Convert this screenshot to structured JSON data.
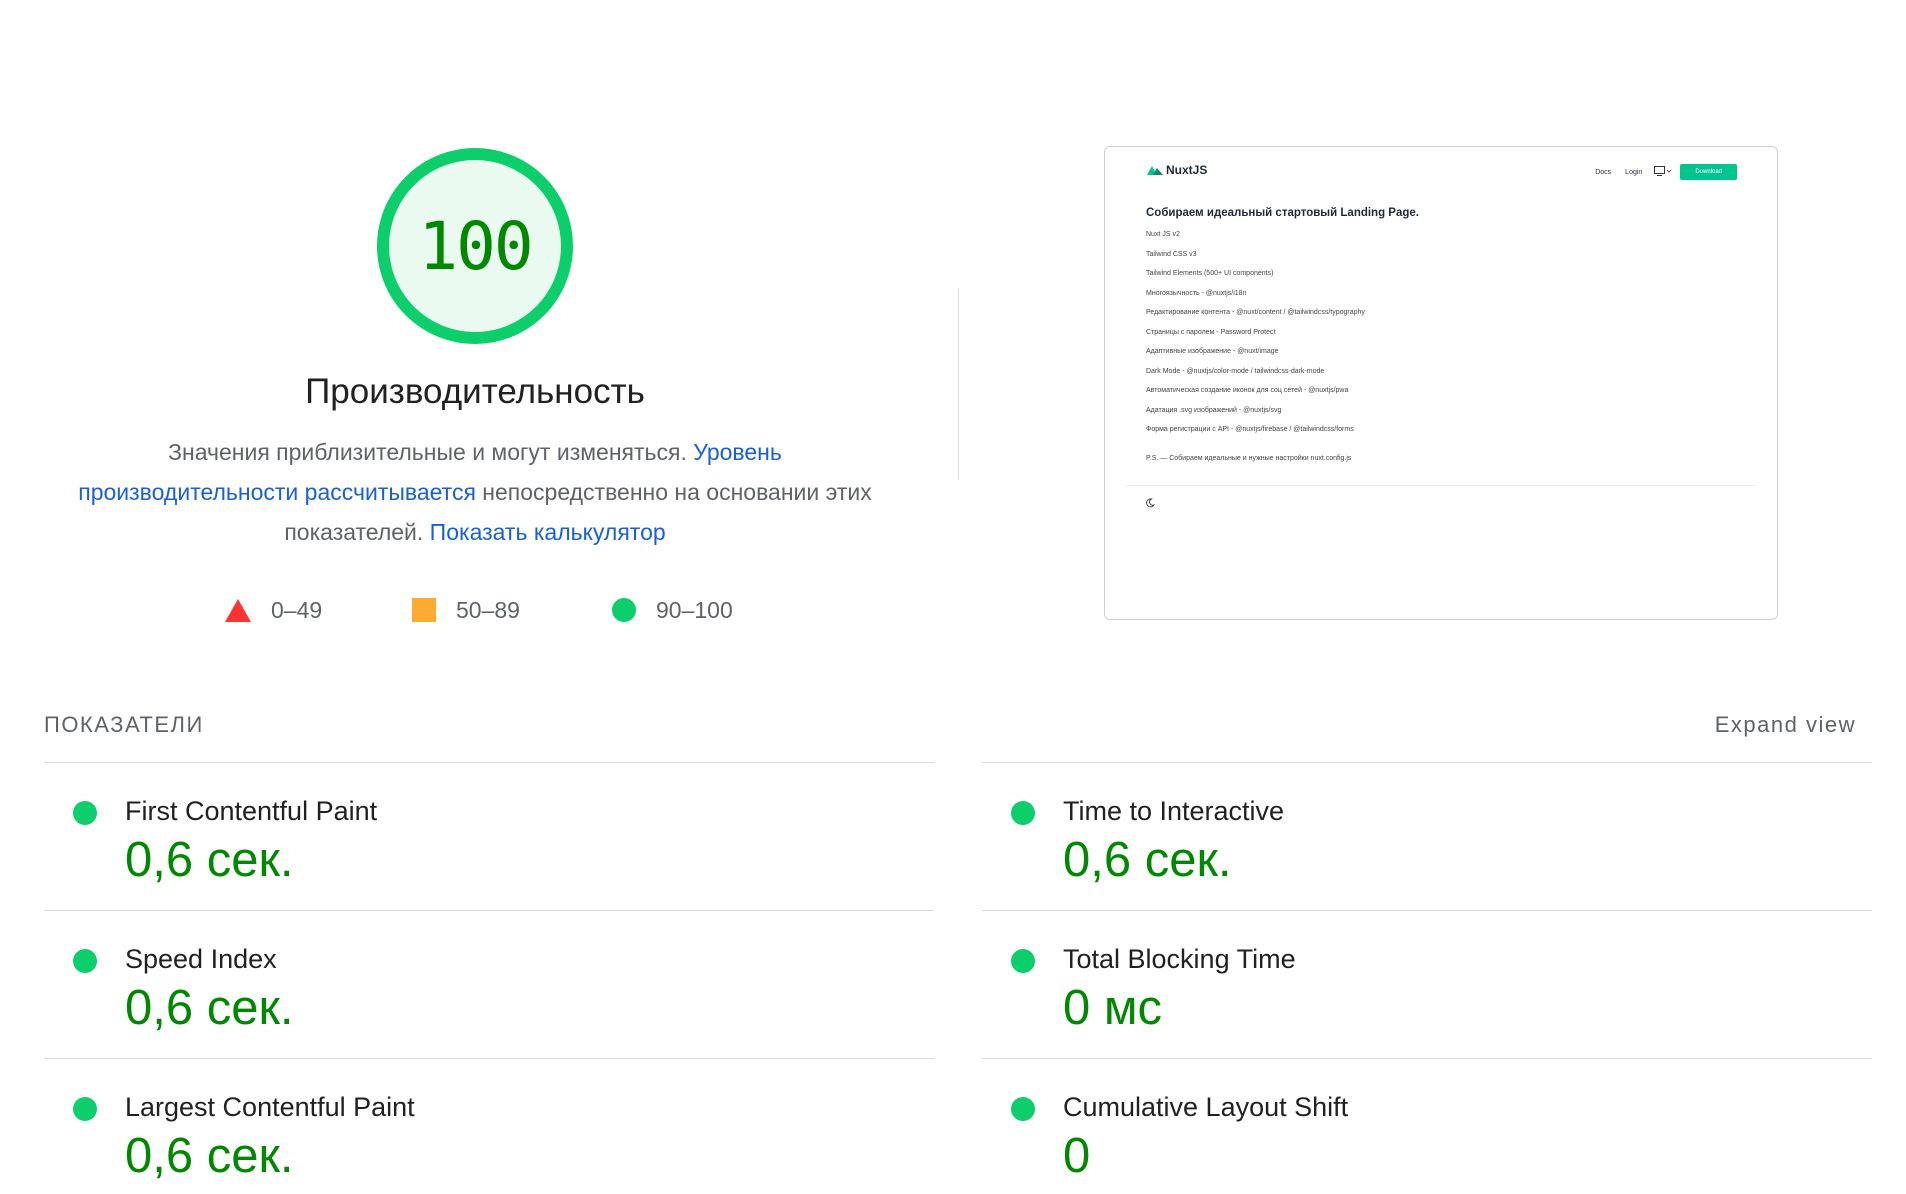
{
  "score": {
    "value": "100",
    "fraction": 1.0,
    "ring_color": "#0cce6b",
    "fill_color": "#eafaf0",
    "text_color": "#008800",
    "title": "Производительность"
  },
  "description": {
    "text1": "Значения приблизительные и могут изменяться. ",
    "link1": "Уровень производительности рассчитывается",
    "text2": " непосредственно на основании этих показателей. ",
    "link2": "Показать калькулятор"
  },
  "legend": [
    {
      "icon": "triangle-icon",
      "label": "0–49",
      "color": "#ff3333"
    },
    {
      "icon": "square-icon",
      "label": "50–89",
      "color": "#ffaa33"
    },
    {
      "icon": "circle-icon",
      "label": "90–100",
      "color": "#0cce6b"
    }
  ],
  "screenshot": {
    "logo": "NuxtJS",
    "nav": [
      "Docs",
      "Login"
    ],
    "download": "Download",
    "heading": "Собираем идеальный стартовый Landing Page.",
    "items": [
      "Nuxt JS v2",
      "Tailwind CSS v3",
      "Tailwind Elements (500+ UI components)",
      "Многоязычность - @nuxtjs/i18n",
      "Редактирование контента - @nuxt/content / @tailwindcss/typography",
      "Страницы с паролем - Password Protect",
      "Адаптивные изображение - @nuxt/image",
      "Dark Mode - @nuxtjs/color-mode / tailwindcss-dark-mode",
      "Автоматическая создание иконок для соц сетей - @nuxtjs/pwa",
      "Адатация .svg изображений - @nuxtjs/svg",
      "Форма регистрации с API - @nuxtjs/firebase / @tailwindcss/forms"
    ],
    "ps": "P.S. — Собираем идеальные и нужные настройки nuxt.config.js"
  },
  "metrics_section": {
    "title": "ПОКАЗАТЕЛИ",
    "expand_label": "Expand view"
  },
  "metrics": [
    {
      "name": "First Contentful Paint",
      "value": "0,6 сек."
    },
    {
      "name": "Time to Interactive",
      "value": "0,6 сек."
    },
    {
      "name": "Speed Index",
      "value": "0,6 сек."
    },
    {
      "name": "Total Blocking Time",
      "value": "0 мс"
    },
    {
      "name": "Largest Contentful Paint",
      "value": "0,6 сек."
    },
    {
      "name": "Cumulative Layout Shift",
      "value": "0"
    }
  ]
}
